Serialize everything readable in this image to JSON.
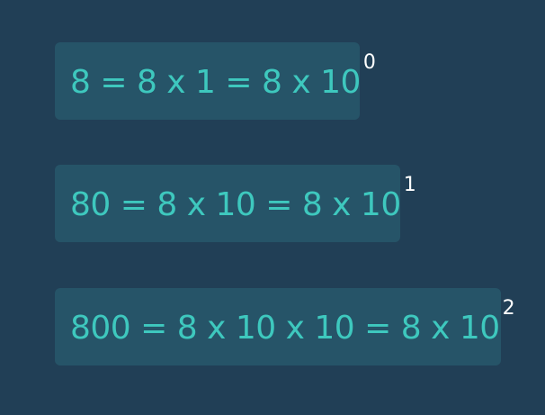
{
  "colors": {
    "background": "#213f56",
    "card": "#265468",
    "equation_text": "#3ec8be",
    "exponent_text": "#ffffff"
  },
  "equations": [
    {
      "text": "8 = 8 x 1 = 8 x 10",
      "exponent": "0"
    },
    {
      "text": "80 = 8 x 10 = 8 x 10",
      "exponent": "1"
    },
    {
      "text": "800 = 8 x 10 x 10 = 8 x 10",
      "exponent": "2"
    }
  ]
}
